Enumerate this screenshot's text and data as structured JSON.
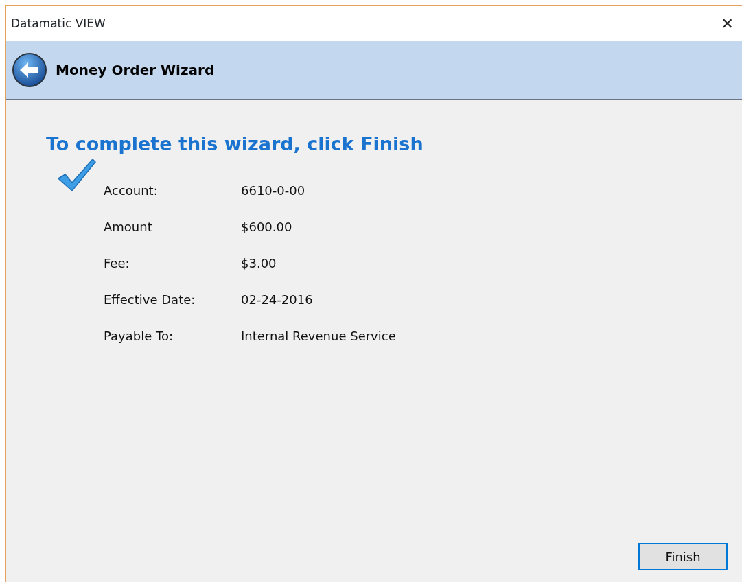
{
  "window": {
    "title": "Datamatic VIEW",
    "close": "✕"
  },
  "header": {
    "title": "Money Order Wizard"
  },
  "heading": "To complete this wizard, click Finish",
  "summary": [
    {
      "label": "Account:",
      "value": "6610-0-00"
    },
    {
      "label": "Amount",
      "value": "$600.00"
    },
    {
      "label": "Fee:",
      "value": "$3.00"
    },
    {
      "label": "Effective Date:",
      "value": "02-24-2016"
    },
    {
      "label": "Payable To:",
      "value": "Internal Revenue Service"
    }
  ],
  "buttons": [
    {
      "label": "Finish",
      "focused": true
    }
  ]
}
